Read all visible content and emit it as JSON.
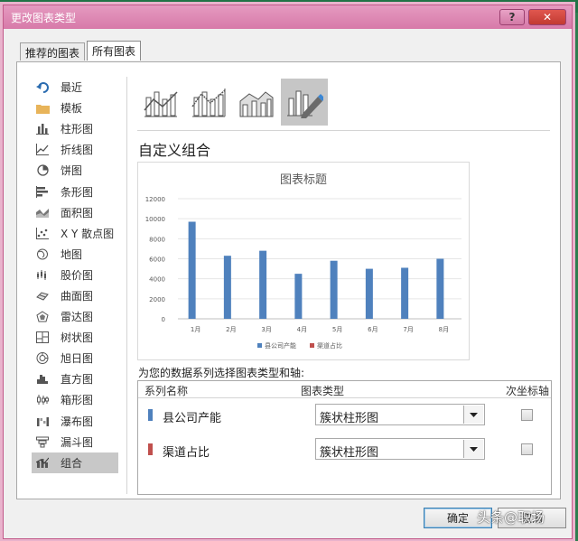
{
  "dialog": {
    "title": "更改图表类型",
    "help_label": "?",
    "close_label": "✕"
  },
  "tabs": [
    {
      "label": "推荐的图表"
    },
    {
      "label": "所有图表"
    }
  ],
  "sidebar": {
    "items": [
      {
        "label": "最近",
        "icon": "undo-icon"
      },
      {
        "label": "模板",
        "icon": "folder-icon"
      },
      {
        "label": "柱形图",
        "icon": "column-chart-icon"
      },
      {
        "label": "折线图",
        "icon": "line-chart-icon"
      },
      {
        "label": "饼图",
        "icon": "pie-chart-icon"
      },
      {
        "label": "条形图",
        "icon": "bar-chart-icon"
      },
      {
        "label": "面积图",
        "icon": "area-chart-icon"
      },
      {
        "label": "X Y 散点图",
        "icon": "scatter-chart-icon"
      },
      {
        "label": "地图",
        "icon": "map-chart-icon"
      },
      {
        "label": "股价图",
        "icon": "stock-chart-icon"
      },
      {
        "label": "曲面图",
        "icon": "surface-chart-icon"
      },
      {
        "label": "雷达图",
        "icon": "radar-chart-icon"
      },
      {
        "label": "树状图",
        "icon": "treemap-chart-icon"
      },
      {
        "label": "旭日图",
        "icon": "sunburst-chart-icon"
      },
      {
        "label": "直方图",
        "icon": "histogram-chart-icon"
      },
      {
        "label": "箱形图",
        "icon": "boxwhisker-chart-icon"
      },
      {
        "label": "瀑布图",
        "icon": "waterfall-chart-icon"
      },
      {
        "label": "漏斗图",
        "icon": "funnel-chart-icon"
      },
      {
        "label": "组合",
        "icon": "combo-chart-icon"
      }
    ],
    "selected": "组合"
  },
  "combo_title": "自定义组合",
  "chart_data": {
    "type": "bar",
    "title": "图表标题",
    "categories": [
      "1月",
      "2月",
      "3月",
      "4月",
      "5月",
      "6月",
      "7月",
      "8月"
    ],
    "series": [
      {
        "name": "县公司产能",
        "color": "#4f81bd",
        "values": [
          9700,
          6300,
          6800,
          4500,
          5800,
          5000,
          5100,
          6000
        ]
      },
      {
        "name": "渠道占比",
        "color": "#c0504d",
        "values": [
          0,
          0,
          0,
          0,
          0,
          0,
          0,
          0
        ]
      }
    ],
    "yticks": [
      "0",
      "2000",
      "4000",
      "6000",
      "8000",
      "10000",
      "12000"
    ],
    "ylim": [
      0,
      12000
    ],
    "legend_position": "bottom",
    "grid": true
  },
  "assign_label": "为您的数据系列选择图表类型和轴:",
  "table": {
    "headers": {
      "name": "系列名称",
      "type": "图表类型",
      "secondary": "次坐标轴"
    },
    "rows": [
      {
        "name": "县公司产能",
        "color": "#4f81bd",
        "type": "簇状柱形图"
      },
      {
        "name": "渠道占比",
        "color": "#c0504d",
        "type": "簇状柱形图"
      }
    ]
  },
  "buttons": {
    "ok": "确定",
    "cancel": "取消"
  },
  "watermark": "头条@职场"
}
